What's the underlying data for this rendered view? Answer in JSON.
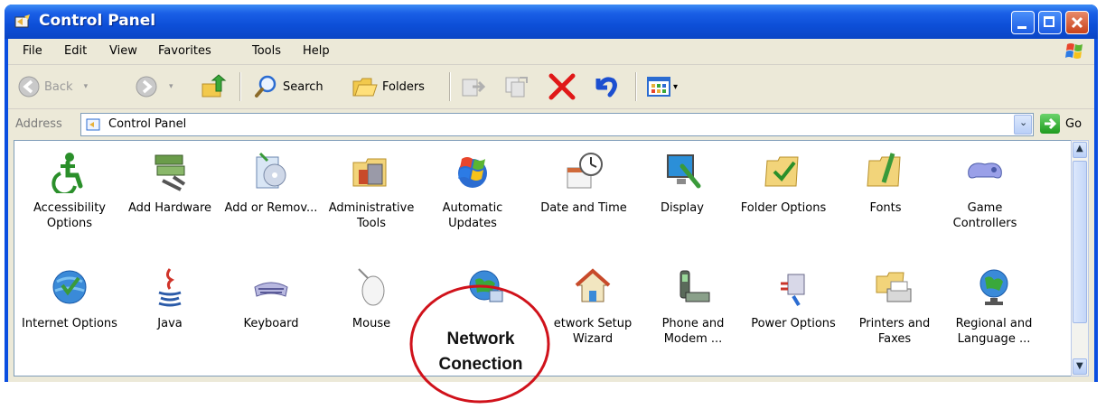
{
  "window": {
    "title": "Control Panel",
    "colors": {
      "titlebar": "#0a4ee0",
      "face": "#ece9d8",
      "annotation": "#d0121b"
    }
  },
  "menu": [
    "File",
    "Edit",
    "View",
    "Favorites",
    "Tools",
    "Help"
  ],
  "toolbar": {
    "back_label": "Back",
    "search_label": "Search",
    "folders_label": "Folders"
  },
  "address": {
    "label": "Address",
    "value": "Control Panel",
    "go_label": "Go"
  },
  "items_row1": [
    {
      "label": "Accessibility Options",
      "icon": "accessibility-icon"
    },
    {
      "label": "Add Hardware",
      "icon": "add-hardware-icon"
    },
    {
      "label": "Add or Remov...",
      "icon": "add-remove-programs-icon"
    },
    {
      "label": "Administrative Tools",
      "icon": "administrative-tools-icon"
    },
    {
      "label": "Automatic Updates",
      "icon": "automatic-updates-icon"
    },
    {
      "label": "Date and Time",
      "icon": "date-time-icon"
    },
    {
      "label": "Display",
      "icon": "display-icon"
    },
    {
      "label": "Folder Options",
      "icon": "folder-options-icon"
    },
    {
      "label": "Fonts",
      "icon": "fonts-icon"
    },
    {
      "label": "Game Controllers",
      "icon": "game-controllers-icon"
    }
  ],
  "items_row2": [
    {
      "label": "Internet Options",
      "icon": "internet-options-icon"
    },
    {
      "label": "Java",
      "icon": "java-icon"
    },
    {
      "label": "Keyboard",
      "icon": "keyboard-icon"
    },
    {
      "label": "Mouse",
      "icon": "mouse-icon"
    },
    {
      "label": "",
      "icon": "network-connections-icon"
    },
    {
      "label": "etwork Setup Wizard",
      "icon": "network-setup-wizard-icon"
    },
    {
      "label": "Phone and Modem ...",
      "icon": "phone-modem-icon"
    },
    {
      "label": "Power Options",
      "icon": "power-options-icon"
    },
    {
      "label": "Printers and Faxes",
      "icon": "printers-faxes-icon"
    },
    {
      "label": "Regional and Language ...",
      "icon": "regional-language-icon"
    }
  ],
  "annotation": {
    "line1": "Network",
    "line2": "Conection"
  }
}
